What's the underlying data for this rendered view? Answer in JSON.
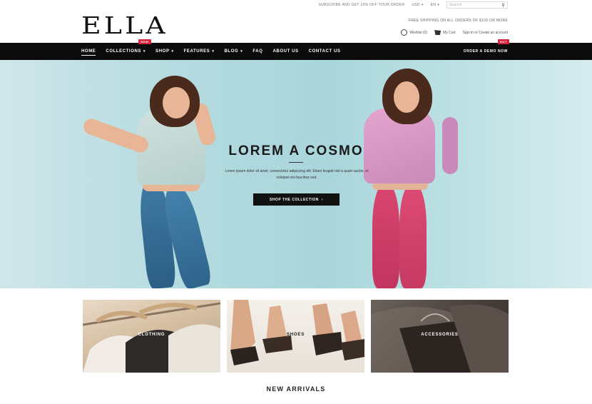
{
  "topbar": {
    "notice": "SUBSCRIBE AND GET 10% OFF YOUR ORDER",
    "currency": "USD",
    "language": "EN",
    "search_placeholder": "Search"
  },
  "header": {
    "logo": "ELLA",
    "promo": "FREE SHIPPING ON ALL ORDERS OF $100 OR MORE",
    "wishlist": "Wishlist (0)",
    "cart": "My Cart",
    "account": "Sign in or Create an account"
  },
  "nav": {
    "items": [
      {
        "label": "HOME",
        "active": true
      },
      {
        "label": "COLLECTIONS",
        "caret": true,
        "badge": "NEW"
      },
      {
        "label": "SHOP",
        "caret": true
      },
      {
        "label": "FEATURES",
        "caret": true
      },
      {
        "label": "BLOG",
        "caret": true
      },
      {
        "label": "FAQ"
      },
      {
        "label": "ABOUT US"
      },
      {
        "label": "CONTACT US"
      }
    ],
    "right_link": "ORDER A DEMO NOW",
    "right_badge": "HOT"
  },
  "hero": {
    "title": "LOREM A COSMO",
    "description": "Lorem ipsum dolor sit amet, consectetur adipiscing elit. Etiam feugiat nisl a quam auctor, et volutpat nisi faucibus sed.",
    "button_label": "SHOP THE COLLECTION",
    "button_icon": "arrow-right-icon"
  },
  "tiles": [
    {
      "label": "CLOTHING"
    },
    {
      "label": "SHOES"
    },
    {
      "label": "ACCESSORIES"
    }
  ],
  "section_title": "NEW ARRIVALS",
  "colors": {
    "nav_bg": "#0b0b0b",
    "accent_badge": "#d6223c",
    "hero_bg": "#a9d6db"
  }
}
